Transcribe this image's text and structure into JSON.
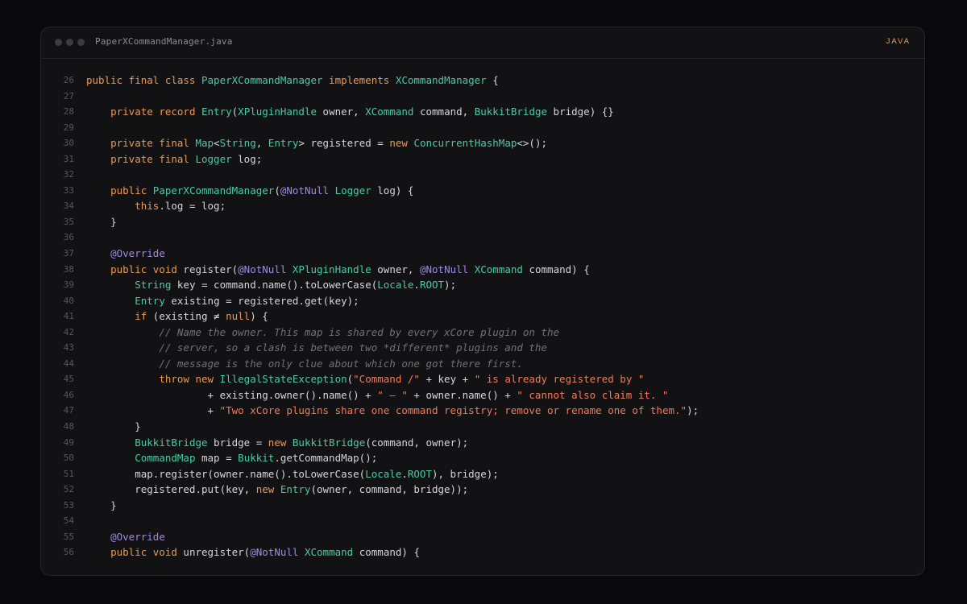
{
  "window": {
    "filename": "PaperXCommandManager.java",
    "language": "JAVA"
  },
  "colors": {
    "background": "#09090b",
    "panel": "#121215",
    "keyword": "#e9994f",
    "type": "#48c9a8",
    "annotation": "#9d8ae0",
    "string": "#f07b55",
    "comment": "#70707a",
    "text": "#d5d5dc"
  },
  "lines": [
    {
      "n": "26",
      "tokens": [
        [
          "kw",
          "public final class "
        ],
        [
          "ty",
          "PaperXCommandManager"
        ],
        [
          "kw",
          " implements "
        ],
        [
          "ty",
          "XCommandManager"
        ],
        [
          "p",
          " {"
        ]
      ]
    },
    {
      "n": "27",
      "tokens": []
    },
    {
      "n": "28",
      "tokens": [
        [
          "p",
          "    "
        ],
        [
          "kw",
          "private record "
        ],
        [
          "ty",
          "Entry"
        ],
        [
          "p",
          "("
        ],
        [
          "ty",
          "XPluginHandle"
        ],
        [
          "p",
          " owner, "
        ],
        [
          "ty",
          "XCommand"
        ],
        [
          "p",
          " command, "
        ],
        [
          "ty",
          "BukkitBridge"
        ],
        [
          "p",
          " bridge) {}"
        ]
      ]
    },
    {
      "n": "29",
      "tokens": []
    },
    {
      "n": "30",
      "tokens": [
        [
          "p",
          "    "
        ],
        [
          "kw",
          "private final "
        ],
        [
          "ty",
          "Map"
        ],
        [
          "p",
          "<"
        ],
        [
          "ty",
          "String"
        ],
        [
          "p",
          ", "
        ],
        [
          "ty",
          "Entry"
        ],
        [
          "p",
          "> registered = "
        ],
        [
          "kw",
          "new "
        ],
        [
          "ty",
          "ConcurrentHashMap"
        ],
        [
          "p",
          "<>();"
        ]
      ]
    },
    {
      "n": "31",
      "tokens": [
        [
          "p",
          "    "
        ],
        [
          "kw",
          "private final "
        ],
        [
          "ty",
          "Logger"
        ],
        [
          "p",
          " log;"
        ]
      ]
    },
    {
      "n": "32",
      "tokens": []
    },
    {
      "n": "33",
      "tokens": [
        [
          "p",
          "    "
        ],
        [
          "kw",
          "public "
        ],
        [
          "ty",
          "PaperXCommandManager"
        ],
        [
          "p",
          "("
        ],
        [
          "an",
          "@NotNull"
        ],
        [
          "p",
          " "
        ],
        [
          "ty",
          "Logger"
        ],
        [
          "p",
          " log) {"
        ]
      ]
    },
    {
      "n": "34",
      "tokens": [
        [
          "p",
          "        "
        ],
        [
          "kw",
          "this"
        ],
        [
          "p",
          ".log = log;"
        ]
      ]
    },
    {
      "n": "35",
      "tokens": [
        [
          "p",
          "    }"
        ]
      ]
    },
    {
      "n": "36",
      "tokens": []
    },
    {
      "n": "37",
      "tokens": [
        [
          "p",
          "    "
        ],
        [
          "an",
          "@Override"
        ]
      ]
    },
    {
      "n": "38",
      "tokens": [
        [
          "p",
          "    "
        ],
        [
          "kw",
          "public void "
        ],
        [
          "p",
          "register("
        ],
        [
          "an",
          "@NotNull"
        ],
        [
          "p",
          " "
        ],
        [
          "ty",
          "XPluginHandle"
        ],
        [
          "p",
          " owner, "
        ],
        [
          "an",
          "@NotNull"
        ],
        [
          "p",
          " "
        ],
        [
          "ty",
          "XCommand"
        ],
        [
          "p",
          " command) {"
        ]
      ]
    },
    {
      "n": "39",
      "tokens": [
        [
          "p",
          "        "
        ],
        [
          "ty",
          "String"
        ],
        [
          "p",
          " key = command.name().toLowerCase("
        ],
        [
          "ty",
          "Locale"
        ],
        [
          "p",
          "."
        ],
        [
          "ty",
          "ROOT"
        ],
        [
          "p",
          ");"
        ]
      ]
    },
    {
      "n": "40",
      "tokens": [
        [
          "p",
          "        "
        ],
        [
          "ty",
          "Entry"
        ],
        [
          "p",
          " existing = registered.get(key);"
        ]
      ]
    },
    {
      "n": "41",
      "tokens": [
        [
          "p",
          "        "
        ],
        [
          "kw",
          "if "
        ],
        [
          "p",
          "(existing ≠ "
        ],
        [
          "kw",
          "null"
        ],
        [
          "p",
          ") {"
        ]
      ]
    },
    {
      "n": "42",
      "tokens": [
        [
          "p",
          "            "
        ],
        [
          "cm",
          "// Name the owner. This map is shared by every xCore plugin on the"
        ]
      ]
    },
    {
      "n": "43",
      "tokens": [
        [
          "p",
          "            "
        ],
        [
          "cm",
          "// server, so a clash is between two *different* plugins and the"
        ]
      ]
    },
    {
      "n": "44",
      "tokens": [
        [
          "p",
          "            "
        ],
        [
          "cm",
          "// message is the only clue about which one got there first."
        ]
      ]
    },
    {
      "n": "45",
      "tokens": [
        [
          "p",
          "            "
        ],
        [
          "kw",
          "throw new "
        ],
        [
          "ty",
          "IllegalStateException"
        ],
        [
          "p",
          "("
        ],
        [
          "str",
          "\"Command /\""
        ],
        [
          "p",
          " + key + "
        ],
        [
          "str",
          "\" is already registered by \""
        ]
      ]
    },
    {
      "n": "46",
      "tokens": [
        [
          "p",
          "                    + existing.owner().name() + "
        ],
        [
          "str",
          "\" — \""
        ],
        [
          "p",
          " + owner.name() + "
        ],
        [
          "str",
          "\" cannot also claim it. \""
        ]
      ]
    },
    {
      "n": "47",
      "tokens": [
        [
          "p",
          "                    + "
        ],
        [
          "str",
          "\"Two xCore plugins share one command registry; remove or rename one of them.\""
        ],
        [
          "p",
          ");"
        ]
      ]
    },
    {
      "n": "48",
      "tokens": [
        [
          "p",
          "        }"
        ]
      ]
    },
    {
      "n": "49",
      "tokens": [
        [
          "p",
          "        "
        ],
        [
          "ty",
          "BukkitBridge"
        ],
        [
          "p",
          " bridge = "
        ],
        [
          "kw",
          "new "
        ],
        [
          "ty",
          "BukkitBridge"
        ],
        [
          "p",
          "(command, owner);"
        ]
      ]
    },
    {
      "n": "50",
      "tokens": [
        [
          "p",
          "        "
        ],
        [
          "ty",
          "CommandMap"
        ],
        [
          "p",
          " map = "
        ],
        [
          "ty",
          "Bukkit"
        ],
        [
          "p",
          ".getCommandMap();"
        ]
      ]
    },
    {
      "n": "51",
      "tokens": [
        [
          "p",
          "        map.register(owner.name().toLowerCase("
        ],
        [
          "ty",
          "Locale"
        ],
        [
          "p",
          "."
        ],
        [
          "ty",
          "ROOT"
        ],
        [
          "p",
          "), bridge);"
        ]
      ]
    },
    {
      "n": "52",
      "tokens": [
        [
          "p",
          "        registered.put(key, "
        ],
        [
          "kw",
          "new "
        ],
        [
          "ty",
          "Entry"
        ],
        [
          "p",
          "(owner, command, bridge));"
        ]
      ]
    },
    {
      "n": "53",
      "tokens": [
        [
          "p",
          "    }"
        ]
      ]
    },
    {
      "n": "54",
      "tokens": []
    },
    {
      "n": "55",
      "tokens": [
        [
          "p",
          "    "
        ],
        [
          "an",
          "@Override"
        ]
      ]
    },
    {
      "n": "56",
      "tokens": [
        [
          "p",
          "    "
        ],
        [
          "kw",
          "public void "
        ],
        [
          "p",
          "unregister("
        ],
        [
          "an",
          "@NotNull"
        ],
        [
          "p",
          " "
        ],
        [
          "ty",
          "XCommand"
        ],
        [
          "p",
          " command) {"
        ]
      ]
    }
  ]
}
